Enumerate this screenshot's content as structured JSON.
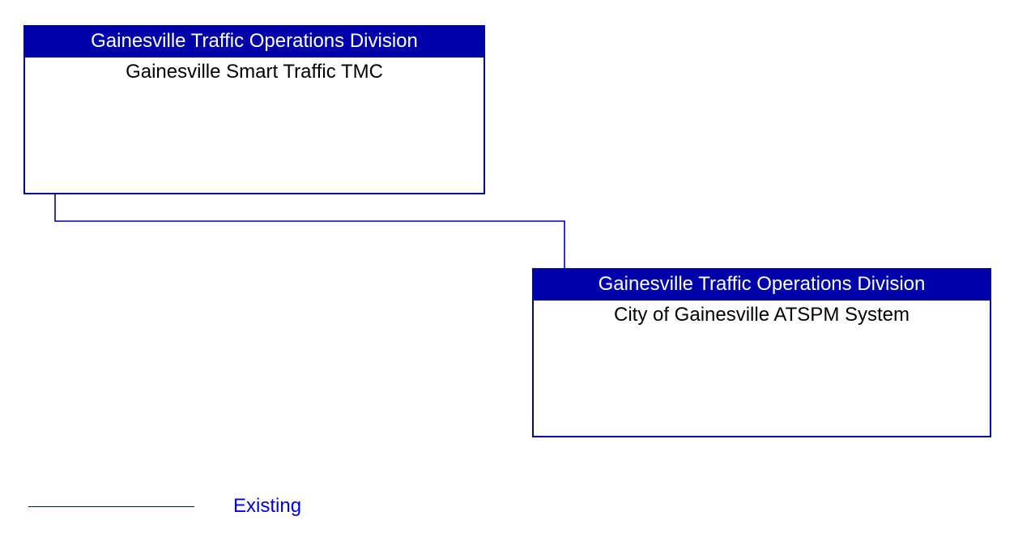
{
  "nodes": {
    "tmc": {
      "header": "Gainesville Traffic Operations Division",
      "body": "Gainesville Smart Traffic TMC"
    },
    "atspm": {
      "header": "Gainesville Traffic Operations Division",
      "body": "City of Gainesville ATSPM System"
    }
  },
  "legend": {
    "existing": "Existing"
  },
  "colors": {
    "header_bg": "#0000aa",
    "header_fg": "#ffffff",
    "border": "#0000aa",
    "connector": "#0000aa",
    "legend": "#0000ee"
  }
}
